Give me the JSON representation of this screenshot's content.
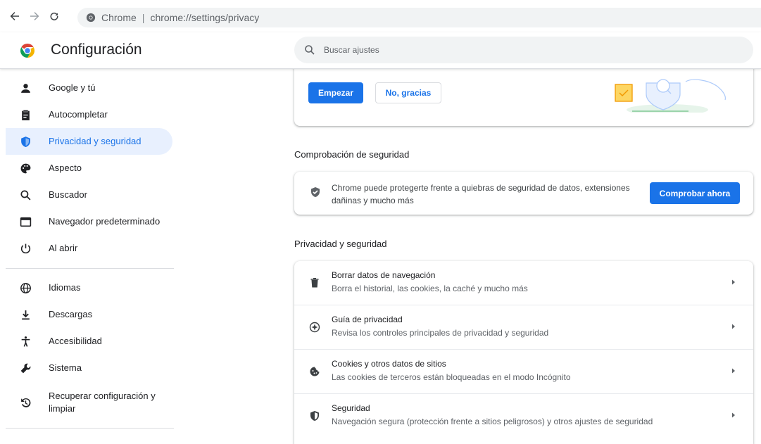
{
  "browser": {
    "site_name": "Chrome",
    "url_path": "chrome://settings/privacy"
  },
  "header": {
    "title": "Configuración",
    "search_placeholder": "Buscar ajustes"
  },
  "sidebar": {
    "items": [
      {
        "label": "Google y tú",
        "icon": "person-icon"
      },
      {
        "label": "Autocompletar",
        "icon": "clipboard-icon"
      },
      {
        "label": "Privacidad y seguridad",
        "icon": "shield-icon",
        "active": true
      },
      {
        "label": "Aspecto",
        "icon": "palette-icon"
      },
      {
        "label": "Buscador",
        "icon": "search-icon"
      },
      {
        "label": "Navegador predeterminado",
        "icon": "browser-icon"
      },
      {
        "label": "Al abrir",
        "icon": "power-icon"
      },
      {
        "label": "Idiomas",
        "icon": "globe-icon"
      },
      {
        "label": "Descargas",
        "icon": "download-icon"
      },
      {
        "label": "Accesibilidad",
        "icon": "accessibility-icon"
      },
      {
        "label": "Sistema",
        "icon": "wrench-icon"
      },
      {
        "label": "Recuperar configuración y limpiar",
        "icon": "restore-icon"
      }
    ]
  },
  "promo": {
    "start_label": "Empezar",
    "decline_label": "No, gracias"
  },
  "safety_check": {
    "section_title": "Comprobación de seguridad",
    "description": "Chrome puede protegerte frente a quiebras de seguridad de datos, extensiones dañinas y mucho más",
    "button_label": "Comprobar ahora"
  },
  "privacy": {
    "section_title": "Privacidad y seguridad",
    "rows": [
      {
        "title": "Borrar datos de navegación",
        "subtitle": "Borra el historial, las cookies, la caché y mucho más",
        "icon": "trash-icon"
      },
      {
        "title": "Guía de privacidad",
        "subtitle": "Revisa los controles principales de privacidad y seguridad",
        "icon": "compass-icon"
      },
      {
        "title": "Cookies y otros datos de sitios",
        "subtitle": "Las cookies de terceros están bloqueadas en el modo Incógnito",
        "icon": "cookie-icon"
      },
      {
        "title": "Seguridad",
        "subtitle": "Navegación segura (protección frente a sitios peligrosos) y otros ajustes de seguridad",
        "icon": "shield-outline-icon"
      }
    ]
  },
  "colors": {
    "accent": "#1a73e8",
    "active_bg": "#e8f0fe",
    "text_primary": "#202124",
    "text_secondary": "#5f6368"
  }
}
